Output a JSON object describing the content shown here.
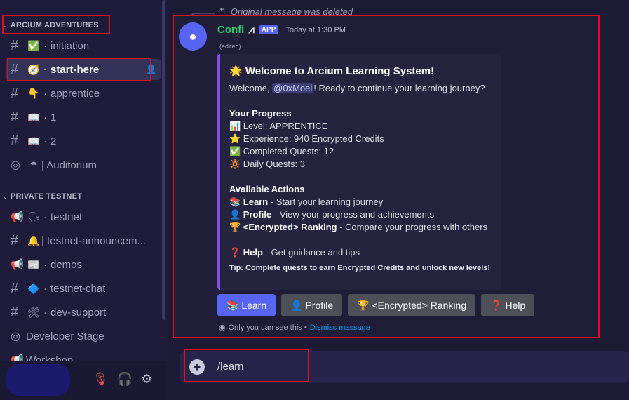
{
  "server": {
    "category_1": "ARCIUM ADVENTURES",
    "category_2": "PRIVATE TESTNET"
  },
  "channels": [
    {
      "icon": "hash",
      "emoji": "✅",
      "label": "initiation"
    },
    {
      "icon": "hash",
      "emoji": "🧭",
      "label": "start-here",
      "active": true
    },
    {
      "icon": "hash",
      "emoji": "👇",
      "label": "apprentice"
    },
    {
      "icon": "hash",
      "emoji": "📖",
      "label": "1"
    },
    {
      "icon": "hash",
      "emoji": "📖",
      "label": "2"
    },
    {
      "icon": "stage",
      "emoji": "☂",
      "label": "| Auditorium"
    },
    {
      "icon": "announcement",
      "emoji": "🗣",
      "label": "testnet"
    },
    {
      "icon": "hash",
      "emoji": "🔔",
      "label": "| testnet-announcem..."
    },
    {
      "icon": "announcement",
      "emoji": "📰",
      "label": "demos"
    },
    {
      "icon": "hash",
      "emoji": "🔷",
      "label": "testnet-chat"
    },
    {
      "icon": "hash",
      "emoji": "🛠",
      "label": "dev-support"
    },
    {
      "icon": "stage",
      "emoji": "",
      "label": "Developer Stage"
    },
    {
      "icon": "announcement",
      "emoji": "",
      "label": "Workshop"
    }
  ],
  "reply": {
    "text": "Original message was deleted"
  },
  "message": {
    "author": "Confi",
    "mark": "⩘",
    "app_tag": "APP",
    "timestamp": "Today at 1:30 PM",
    "edited": "(edited)"
  },
  "embed": {
    "title": "🌟 Welcome to Arcium Learning System!",
    "welcome_pre": "Welcome, ",
    "mention": "@0xMoei",
    "welcome_post": "! Ready to continue your learning journey?",
    "progress_title": "Your Progress",
    "level": "📊 Level: APPRENTICE",
    "experience": "⭐ Experience: 940 Encrypted Credits",
    "quests": "✅ Completed Quests: 12",
    "daily": "🔆 Daily Quests: 3",
    "actions_title": "Available Actions",
    "learn_label": "📚 Learn",
    "learn_desc": " - Start your learning journey",
    "profile_label": "👤 Profile",
    "profile_desc": " - View your progress and achievements",
    "ranking_label": "🏆 <Encrypted> Ranking",
    "ranking_desc": " - Compare your progress with others",
    "help_label": "❓ Help",
    "help_desc": " - Get guidance and tips",
    "tip": "Tip: Complete quests to earn Encrypted Credits and unlock new levels!"
  },
  "buttons": {
    "learn": "📚 Learn",
    "profile": "👤 Profile",
    "ranking": "🏆 <Encrypted> Ranking",
    "help": "❓ Help"
  },
  "ephemeral": {
    "text": "Only you can see this •",
    "dismiss": "Dismiss message"
  },
  "input": {
    "value": "/learn"
  },
  "colors": {
    "accent": "#5865f2",
    "highlight": "#e0101a",
    "embed_bar": "#8a4be0",
    "author": "#2ecc71"
  }
}
